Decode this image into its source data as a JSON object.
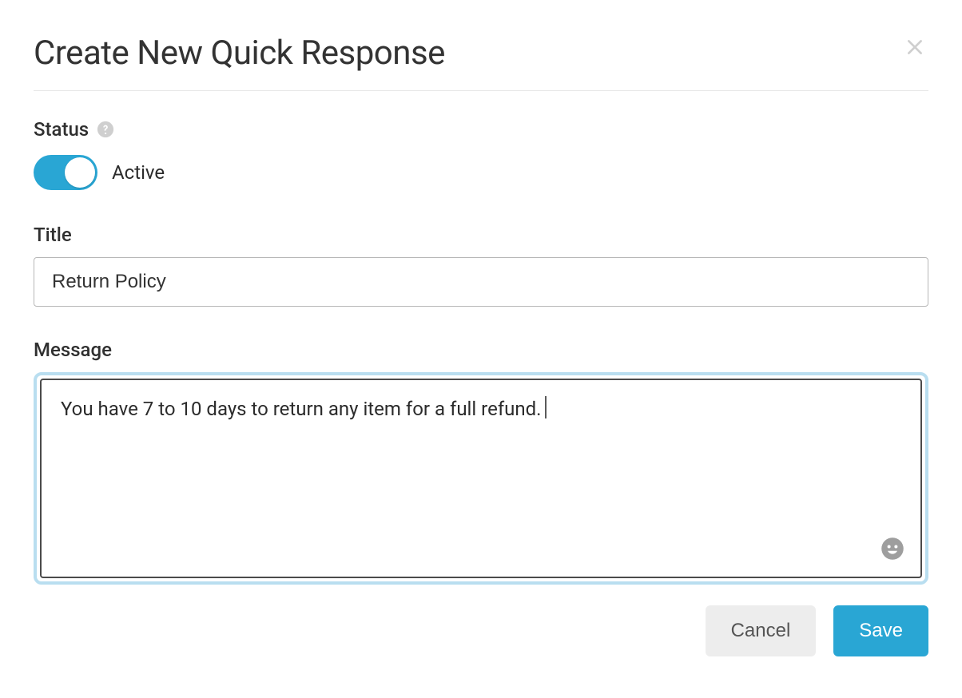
{
  "header": {
    "title": "Create New Quick Response"
  },
  "status": {
    "label": "Status",
    "toggle_state": "Active"
  },
  "title_field": {
    "label": "Title",
    "value": "Return Policy"
  },
  "message_field": {
    "label": "Message",
    "value": "You have 7 to 10 days to return any item for a full refund."
  },
  "footer": {
    "cancel_label": "Cancel",
    "save_label": "Save"
  },
  "colors": {
    "accent": "#29a6d4",
    "focus_ring": "#b9def0"
  }
}
